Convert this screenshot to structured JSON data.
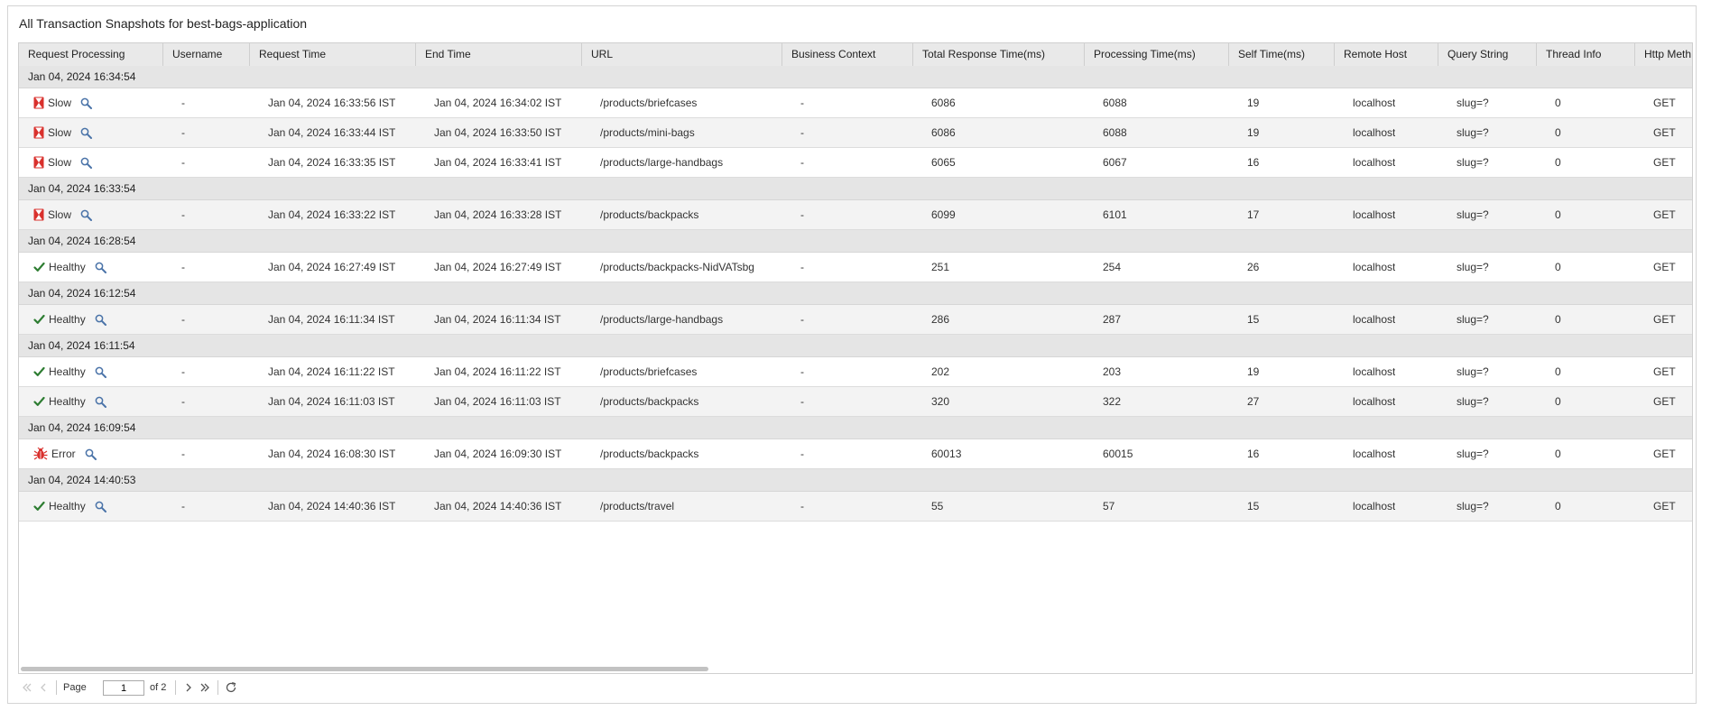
{
  "title": "All Transaction Snapshots for best-bags-application",
  "columns": [
    "Request Processing",
    "Username",
    "Request Time",
    "End Time",
    "URL",
    "Business Context",
    "Total Response Time(ms)",
    "Processing Time(ms)",
    "Self Time(ms)",
    "Remote Host",
    "Query String",
    "Thread Info",
    "Http Meth"
  ],
  "groups": [
    {
      "label": "Jan 04, 2024 16:34:54",
      "rows": [
        {
          "status": "Slow",
          "kind": "slow",
          "username": "-",
          "request_time": "Jan 04, 2024 16:33:56 IST",
          "end_time": "Jan 04, 2024 16:34:02 IST",
          "url": "/products/briefcases",
          "business_context": "-",
          "total_response": "6086",
          "processing": "6088",
          "self_time": "19",
          "remote_host": "localhost",
          "query_string": "slug=?",
          "thread_info": "0",
          "http_method": "GET"
        },
        {
          "status": "Slow",
          "kind": "slow",
          "username": "-",
          "request_time": "Jan 04, 2024 16:33:44 IST",
          "end_time": "Jan 04, 2024 16:33:50 IST",
          "url": "/products/mini-bags",
          "business_context": "-",
          "total_response": "6086",
          "processing": "6088",
          "self_time": "19",
          "remote_host": "localhost",
          "query_string": "slug=?",
          "thread_info": "0",
          "http_method": "GET"
        },
        {
          "status": "Slow",
          "kind": "slow",
          "username": "-",
          "request_time": "Jan 04, 2024 16:33:35 IST",
          "end_time": "Jan 04, 2024 16:33:41 IST",
          "url": "/products/large-handbags",
          "business_context": "-",
          "total_response": "6065",
          "processing": "6067",
          "self_time": "16",
          "remote_host": "localhost",
          "query_string": "slug=?",
          "thread_info": "0",
          "http_method": "GET"
        }
      ]
    },
    {
      "label": "Jan 04, 2024 16:33:54",
      "rows": [
        {
          "status": "Slow",
          "kind": "slow",
          "username": "-",
          "request_time": "Jan 04, 2024 16:33:22 IST",
          "end_time": "Jan 04, 2024 16:33:28 IST",
          "url": "/products/backpacks",
          "business_context": "-",
          "total_response": "6099",
          "processing": "6101",
          "self_time": "17",
          "remote_host": "localhost",
          "query_string": "slug=?",
          "thread_info": "0",
          "http_method": "GET"
        }
      ]
    },
    {
      "label": "Jan 04, 2024 16:28:54",
      "rows": [
        {
          "status": "Healthy",
          "kind": "healthy",
          "username": "-",
          "request_time": "Jan 04, 2024 16:27:49 IST",
          "end_time": "Jan 04, 2024 16:27:49 IST",
          "url": "/products/backpacks-NidVATsbg",
          "business_context": "-",
          "total_response": "251",
          "processing": "254",
          "self_time": "26",
          "remote_host": "localhost",
          "query_string": "slug=?",
          "thread_info": "0",
          "http_method": "GET"
        }
      ]
    },
    {
      "label": "Jan 04, 2024 16:12:54",
      "rows": [
        {
          "status": "Healthy",
          "kind": "healthy",
          "username": "-",
          "request_time": "Jan 04, 2024 16:11:34 IST",
          "end_time": "Jan 04, 2024 16:11:34 IST",
          "url": "/products/large-handbags",
          "business_context": "-",
          "total_response": "286",
          "processing": "287",
          "self_time": "15",
          "remote_host": "localhost",
          "query_string": "slug=?",
          "thread_info": "0",
          "http_method": "GET"
        }
      ]
    },
    {
      "label": "Jan 04, 2024 16:11:54",
      "rows": [
        {
          "status": "Healthy",
          "kind": "healthy",
          "username": "-",
          "request_time": "Jan 04, 2024 16:11:22 IST",
          "end_time": "Jan 04, 2024 16:11:22 IST",
          "url": "/products/briefcases",
          "business_context": "-",
          "total_response": "202",
          "processing": "203",
          "self_time": "19",
          "remote_host": "localhost",
          "query_string": "slug=?",
          "thread_info": "0",
          "http_method": "GET"
        },
        {
          "status": "Healthy",
          "kind": "healthy",
          "username": "-",
          "request_time": "Jan 04, 2024 16:11:03 IST",
          "end_time": "Jan 04, 2024 16:11:03 IST",
          "url": "/products/backpacks",
          "business_context": "-",
          "total_response": "320",
          "processing": "322",
          "self_time": "27",
          "remote_host": "localhost",
          "query_string": "slug=?",
          "thread_info": "0",
          "http_method": "GET"
        }
      ]
    },
    {
      "label": "Jan 04, 2024 16:09:54",
      "rows": [
        {
          "status": "Error",
          "kind": "error",
          "username": "-",
          "request_time": "Jan 04, 2024 16:08:30 IST",
          "end_time": "Jan 04, 2024 16:09:30 IST",
          "url": "/products/backpacks",
          "business_context": "-",
          "total_response": "60013",
          "processing": "60015",
          "self_time": "16",
          "remote_host": "localhost",
          "query_string": "slug=?",
          "thread_info": "0",
          "http_method": "GET"
        }
      ]
    },
    {
      "label": "Jan 04, 2024 14:40:53",
      "rows": [
        {
          "status": "Healthy",
          "kind": "healthy",
          "username": "-",
          "request_time": "Jan 04, 2024 14:40:36 IST",
          "end_time": "Jan 04, 2024 14:40:36 IST",
          "url": "/products/travel",
          "business_context": "-",
          "total_response": "55",
          "processing": "57",
          "self_time": "15",
          "remote_host": "localhost",
          "query_string": "slug=?",
          "thread_info": "0",
          "http_method": "GET"
        }
      ]
    }
  ],
  "pager": {
    "page_label": "Page",
    "page_value": "1",
    "of_label": "of 2"
  },
  "icons": {
    "slow": "hourglass-icon",
    "healthy": "checkmark-icon",
    "error": "bug-icon",
    "search": "search-icon"
  },
  "colors": {
    "slow": "#d9302c",
    "healthy": "#2e7d32",
    "error": "#d9302c",
    "search": "#4a73a8"
  }
}
